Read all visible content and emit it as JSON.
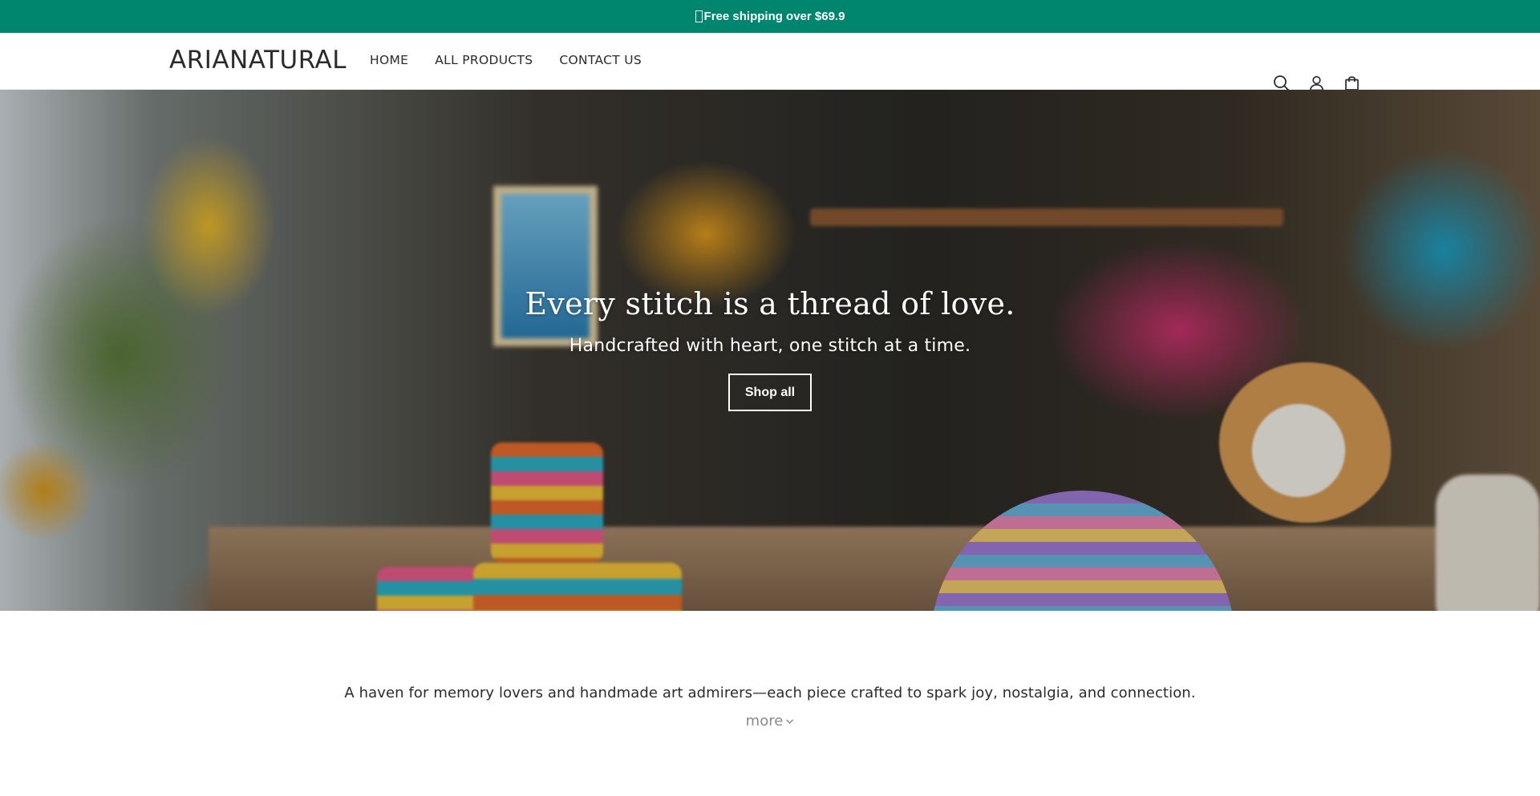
{
  "announcement": {
    "text": "Free shipping over $69.9"
  },
  "header": {
    "logo": "ARIANATURAL",
    "nav": [
      {
        "label": "HOME"
      },
      {
        "label": "ALL PRODUCTS"
      },
      {
        "label": "CONTACT US"
      }
    ],
    "icons": [
      "search-icon",
      "account-icon",
      "cart-icon"
    ]
  },
  "hero": {
    "title": "Every stitch is a thread of love.",
    "subtitle": "Handcrafted with heart, one stitch at a time.",
    "button_label": "Shop all"
  },
  "intro": {
    "text": "A haven for memory lovers and handmade art admirers—each piece crafted to spark joy, nostalgia, and connection.",
    "more_label": "more"
  },
  "colors": {
    "announcement_bg": "#00856f",
    "text": "#2b2b2b",
    "muted": "#8a8a8a"
  }
}
